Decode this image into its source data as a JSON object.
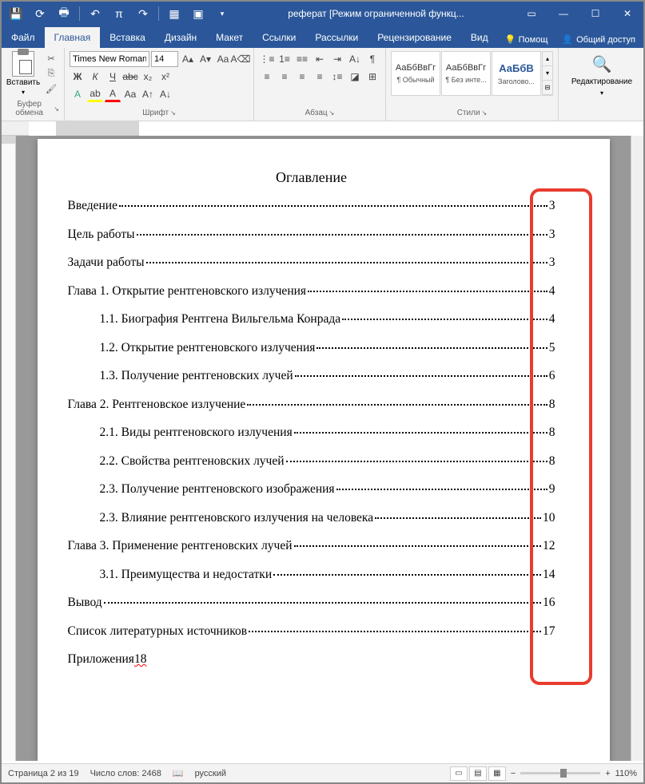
{
  "titlebar": {
    "title": "реферат [Режим ограниченной функц..."
  },
  "tabs": {
    "file": "Файл",
    "home": "Главная",
    "insert": "Вставка",
    "design": "Дизайн",
    "layout": "Макет",
    "references": "Ссылки",
    "mailings": "Рассылки",
    "review": "Рецензирование",
    "view": "Вид",
    "help": "Помощ",
    "share": "Общий доступ"
  },
  "ribbon": {
    "clipboard": {
      "paste": "Вставить",
      "label": "Буфер обмена"
    },
    "font": {
      "name": "Times New Roman",
      "size": "14",
      "label": "Шрифт"
    },
    "paragraph": {
      "label": "Абзац"
    },
    "styles": {
      "label": "Стили",
      "preview": "АаБбВвГг",
      "preview_h": "АаБбВ",
      "s1": "¶ Обычный",
      "s2": "¶ Без инте...",
      "s3": "Заголово..."
    },
    "editing": {
      "label": "Редактирование"
    }
  },
  "document": {
    "toc_title": "Оглавление",
    "entries": [
      {
        "text": "Введение",
        "page": "3",
        "indent": false
      },
      {
        "text": "Цель работы",
        "page": "3",
        "indent": false
      },
      {
        "text": "Задачи работы",
        "page": "3",
        "indent": false
      },
      {
        "text": "Глава 1. Открытие рентгеновского излучения",
        "page": "4",
        "indent": false
      },
      {
        "text": "1.1. Биография Рентгена Вильгельма Конрада",
        "page": "4",
        "indent": true
      },
      {
        "text": "1.2. Открытие рентгеновского излучения",
        "page": "5",
        "indent": true
      },
      {
        "text": "1.3. Получение рентгеновских лучей",
        "page": "6",
        "indent": true
      },
      {
        "text": "Глава 2. Рентгеновское излучение",
        "page": "8",
        "indent": false
      },
      {
        "text": "2.1. Виды рентгеновского излучения",
        "page": "8",
        "indent": true
      },
      {
        "text": "2.2. Свойства рентгеновских лучей",
        "page": "8",
        "indent": true
      },
      {
        "text": "2.3. Получение рентгеновского изображения",
        "page": "9",
        "indent": true
      },
      {
        "text": "2.3. Влияние рентгеновского излучения на человека",
        "page": "10",
        "indent": true
      },
      {
        "text": "Глава 3. Применение рентгеновских лучей",
        "page": "12",
        "indent": false
      },
      {
        "text": "3.1. Преимущества и недостатки",
        "page": "14",
        "indent": true
      },
      {
        "text": "Вывод",
        "page": "16",
        "indent": false
      },
      {
        "text": "Список литературных источников",
        "page": "17",
        "indent": false
      }
    ],
    "last_entry": {
      "text": "Приложения",
      "page": "18"
    }
  },
  "statusbar": {
    "page": "Страница 2 из 19",
    "words": "Число слов: 2468",
    "lang": "русский",
    "zoom": "110%"
  }
}
